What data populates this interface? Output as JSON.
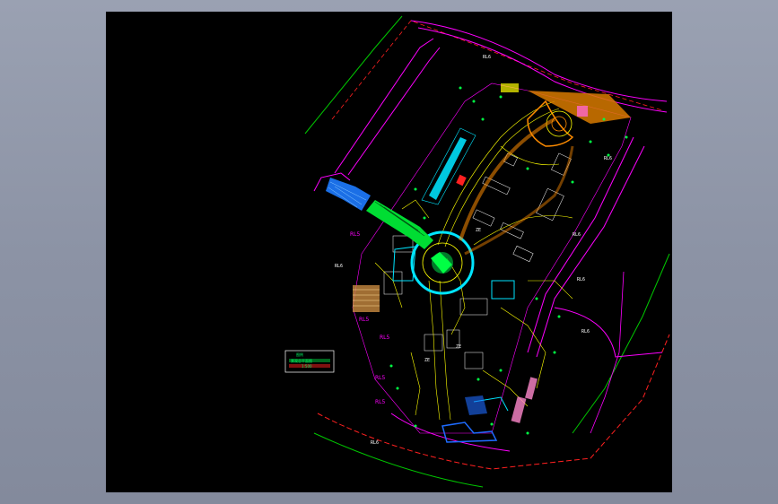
{
  "drawing": {
    "description_free": true,
    "background_color": "#000000",
    "viewer_color": "#8d94a6",
    "layer_colors": {
      "boundary": "#ff2a2a",
      "road": "#ff00ff",
      "green_line": "#00d000",
      "building": "#ffff00",
      "water": "#00e5ff",
      "paving": "#ff8c00",
      "hatch_green": "#00ff33",
      "blue_block": "#1e6bff",
      "white": "#ffffff"
    }
  },
  "annotations": {
    "area_tag": "RL6",
    "area_tag_alt": "RL5",
    "block_label": "ZE",
    "legend_title": "图例",
    "legend_line1": "景观总平面图",
    "legend_line2": "1:500"
  }
}
